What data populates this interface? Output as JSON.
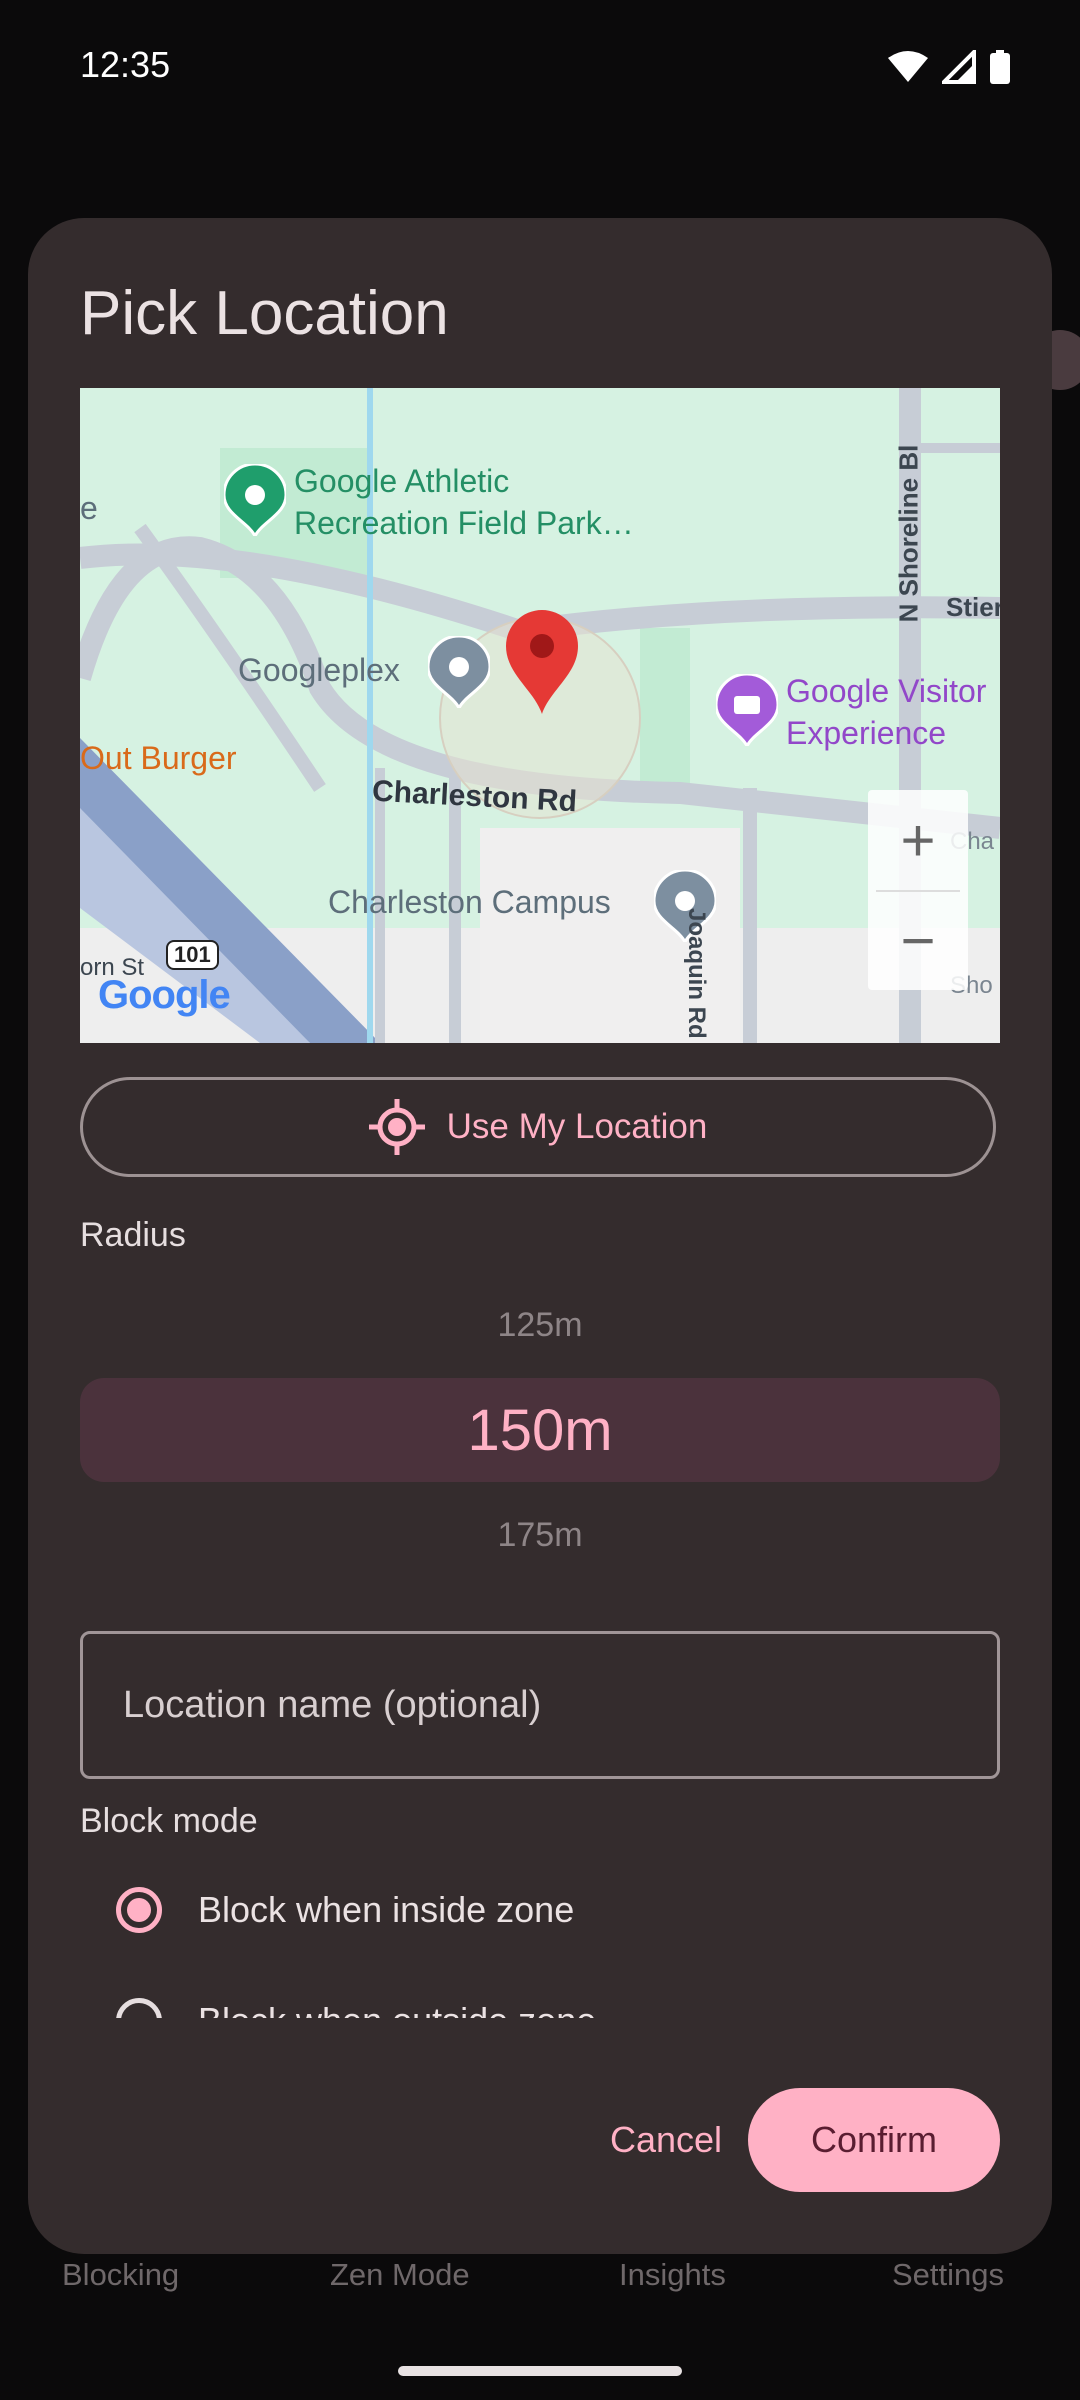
{
  "status_bar": {
    "time": "12:35"
  },
  "dialog": {
    "title": "Pick Location",
    "map": {
      "labels": {
        "athletic": "Google Athletic Recreation Field Park…",
        "googleplex": "Googleplex",
        "visitor": "Google Visitor Experience",
        "out_burger": "Out Burger",
        "charleston_rd": "Charleston Rd",
        "charleston_campus": "Charleston Campus",
        "shoreline": "N Shoreline Bl",
        "joaquin": "Joaquin Rd",
        "stierlin": "Stier",
        "born_st": "orn St",
        "hwy": "101",
        "cha": "Cha",
        "sho": "Sho",
        "edge_e": "e",
        "google_logo": "Google"
      },
      "zoom_in": "+",
      "zoom_out": "−"
    },
    "use_location_label": "Use My Location",
    "radius_label": "Radius",
    "radius_options": {
      "prev": "125m",
      "selected": "150m",
      "next": "175m"
    },
    "name_field_placeholder": "Location name (optional)",
    "block_mode_label": "Block mode",
    "block_modes": [
      {
        "label": "Block when inside zone",
        "selected": true
      },
      {
        "label": "Block when outside zone",
        "selected": false
      }
    ],
    "cancel_label": "Cancel",
    "confirm_label": "Confirm"
  },
  "bottom_nav": {
    "items": [
      "Blocking",
      "Zen Mode",
      "Insights",
      "Settings"
    ]
  },
  "colors": {
    "accent": "#ffb1c5",
    "dialog_bg": "#342c2d",
    "selected_bg": "#4b323c",
    "map_green": "#d7f3e3"
  }
}
